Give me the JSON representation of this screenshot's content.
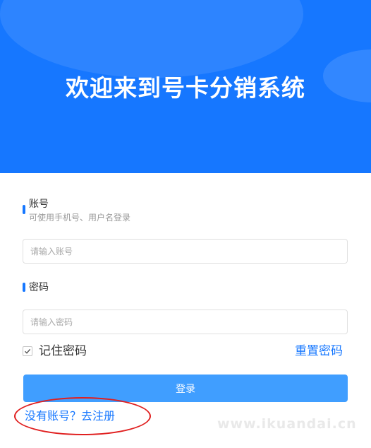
{
  "hero": {
    "title": "欢迎来到号卡分销系统"
  },
  "account": {
    "label": "账号",
    "hint": "可使用手机号、用户名登录",
    "placeholder": "请输入账号"
  },
  "password": {
    "label": "密码",
    "placeholder": "请输入密码"
  },
  "remember": {
    "label": "记住密码",
    "checked": true
  },
  "reset": {
    "label": "重置密码"
  },
  "login": {
    "label": "登录"
  },
  "register": {
    "label": "没有账号？去注册"
  },
  "watermark": {
    "text": "www.ikuandai.cn"
  },
  "colors": {
    "primary": "#1677ff",
    "button": "#409eff",
    "annotation": "#e02020"
  }
}
